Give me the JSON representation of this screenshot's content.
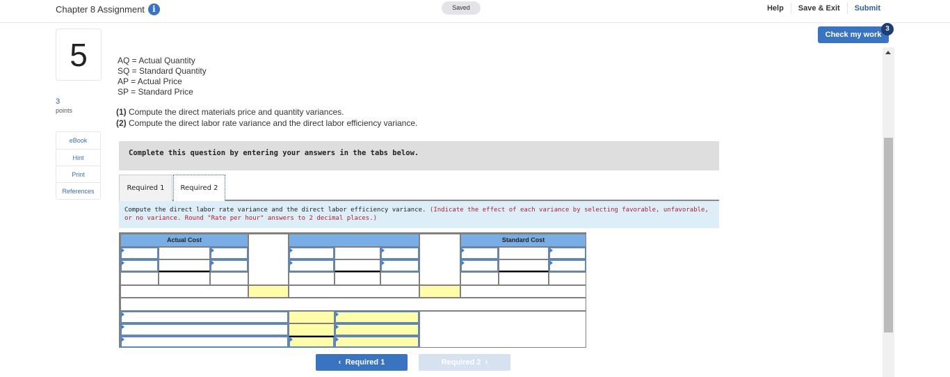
{
  "header": {
    "title": "Chapter 8 Assignment",
    "info_icon": "info-icon",
    "status": "Saved",
    "links": {
      "help": "Help",
      "save_exit": "Save & Exit",
      "submit": "Submit"
    },
    "check_my_work": "Check my work",
    "check_badge": "3"
  },
  "question": {
    "number": "5",
    "points_value": "3",
    "points_label": "points",
    "side_links": [
      "eBook",
      "Hint",
      "Print",
      "References"
    ],
    "definitions": [
      "AQ = Actual Quantity",
      "SQ = Standard Quantity",
      "AP = Actual Price",
      "SP = Standard Price"
    ],
    "tasks": [
      {
        "num": "(1)",
        "text": " Compute the direct materials price and quantity variances."
      },
      {
        "num": "(2)",
        "text": " Compute the direct labor rate variance and the direct labor efficiency variance."
      }
    ]
  },
  "panel": {
    "banner": "Complete this question by entering your answers in the tabs below.",
    "tabs": [
      {
        "label": "Required 1",
        "active": false
      },
      {
        "label": "Required 2",
        "active": true
      }
    ],
    "prompt_main": "Compute the direct labor rate variance and the direct labor efficiency variance. ",
    "prompt_note": "(Indicate the effect of each variance by selecting favorable, unfavorable, or no variance. Round \"Rate per hour\" answers to 2 decimal places.)",
    "table": {
      "headers": {
        "actual": "Actual Cost",
        "middle": "",
        "standard": "Standard Cost"
      }
    },
    "nav": {
      "prev": "Required 1",
      "next": "Required 2",
      "prev_icon": "‹",
      "next_icon": "›"
    }
  },
  "colors": {
    "accent": "#3a74c0",
    "header_blue": "#78aee3",
    "answer_yellow": "#fffcaa",
    "note_red": "#b0202a"
  }
}
